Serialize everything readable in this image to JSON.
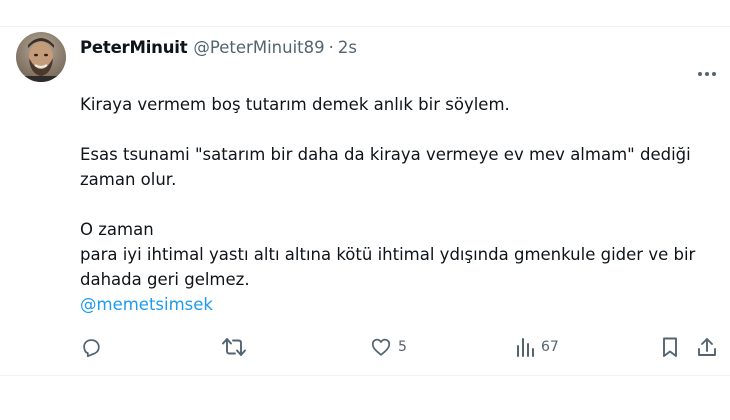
{
  "tweet": {
    "author": {
      "display_name": "PeterMinuit",
      "handle": "@PeterMinuit89",
      "separator": "·",
      "time": "2s"
    },
    "body_lines": [
      "Kiraya vermem boş tutarım demek anlık bir söylem.",
      "Esas tsunami \"satarım bir daha da kiraya vermeye ev mev almam\" dediği",
      "zaman olur.",
      "O zaman",
      "para iyi ihtimal yastı altı altına kötü ihtimal ydışında gmenkule gider ve bir",
      "dahada geri gelmez."
    ],
    "mention": "@memetsimsek",
    "actions": {
      "reply_count": "",
      "retweet_count": "",
      "like_count": "5",
      "views_count": "67"
    },
    "icons": {
      "more": "more-horizontal-icon",
      "reply": "reply-icon",
      "retweet": "retweet-icon",
      "like": "heart-icon",
      "views": "views-icon",
      "bookmark": "bookmark-icon",
      "share": "share-icon"
    },
    "colors": {
      "text": "#0f1419",
      "secondary": "#536471",
      "link": "#1d9bf0"
    }
  }
}
